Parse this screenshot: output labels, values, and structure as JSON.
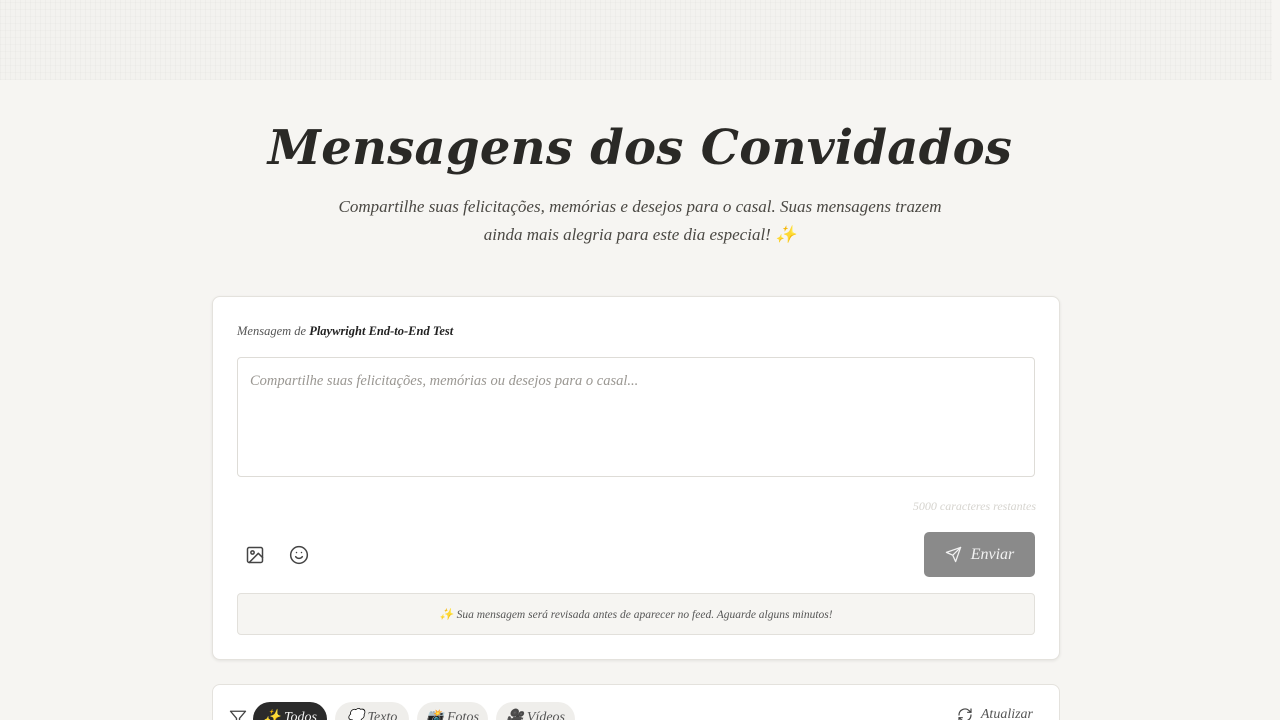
{
  "header": {
    "title": "Mensagens dos Convidados",
    "subtitle": "Compartilhe suas felicitações, memórias e desejos para o casal. Suas mensagens trazem ainda mais alegria para este dia especial! ✨"
  },
  "composer": {
    "author_prefix": "Mensagem de",
    "author_name": "Playwright End-to-End Test",
    "placeholder": "Compartilhe suas felicitações, memórias ou desejos para o casal...",
    "value": "",
    "chars_remaining": "5000 caracteres restantes",
    "send_label": "Enviar",
    "image_icon": "image-icon",
    "emoji_icon": "smile-icon",
    "send_icon": "send-icon",
    "notice": "✨ Sua mensagem será revisada antes de aparecer no feed. Aguarde alguns minutos!"
  },
  "filters": {
    "icon": "filter-icon",
    "items": [
      {
        "label": "✨ Todos",
        "active": true
      },
      {
        "label": "💭 Texto",
        "active": false
      },
      {
        "label": "📸 Fotos",
        "active": false
      },
      {
        "label": "🎥 Vídeos",
        "active": false
      }
    ],
    "refresh_label": "Atualizar",
    "refresh_icon": "refresh-icon"
  },
  "colors": {
    "background": "#f6f5f2",
    "send_button": "#8a8a8a",
    "active_chip": "#2b2b2b"
  }
}
